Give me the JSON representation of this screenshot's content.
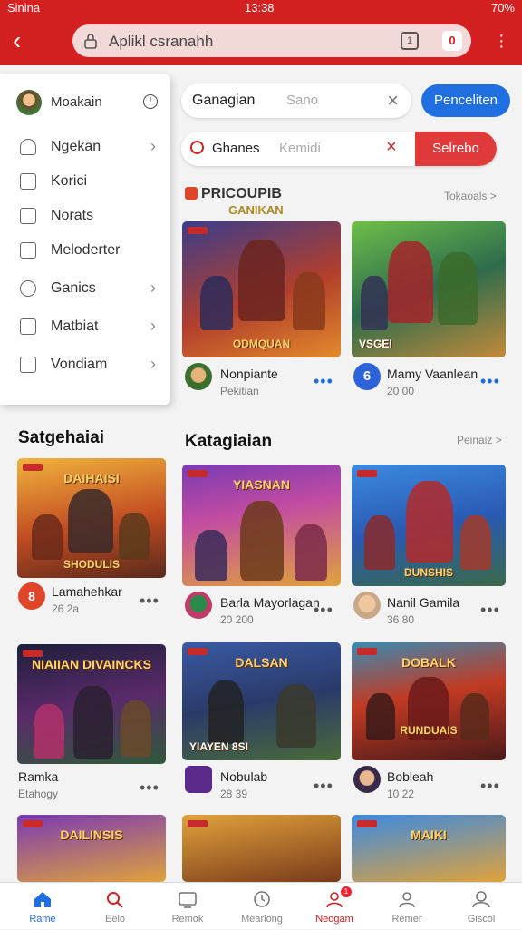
{
  "status": {
    "carrier": "Sinina",
    "time": "13:38",
    "battery": "70%"
  },
  "browser": {
    "url_text": "Aplikl csranahh",
    "tab_count": "1",
    "active_tab": "0"
  },
  "menu": {
    "header": "Moakain",
    "items": [
      {
        "label": "Ngekan",
        "icon": "person-icon",
        "chevron": true
      },
      {
        "label": "Korici",
        "icon": "bag-icon",
        "chevron": false
      },
      {
        "label": "Norats",
        "icon": "document-icon",
        "chevron": false
      },
      {
        "label": "Meloderter",
        "icon": "grid-icon",
        "chevron": false
      },
      {
        "label": "Ganics",
        "icon": "gamepad-icon",
        "chevron": true
      },
      {
        "label": "Matbiat",
        "icon": "bag-icon",
        "chevron": true
      },
      {
        "label": "Vondiam",
        "icon": "info-icon",
        "chevron": true
      }
    ]
  },
  "search1": {
    "label": "Ganagian",
    "placeholder": "Sano",
    "button": "Penceliten"
  },
  "search2": {
    "label": "Ghanes",
    "placeholder": "Kemidi",
    "button": "Selrebo"
  },
  "section_featured": {
    "title": "PRICOUPIB",
    "subtitle": "GANIKAN",
    "see_all": "Tokaoals >"
  },
  "featured": [
    {
      "banner": "ODMQUAN",
      "title": "Nonpiante",
      "sub": "Pekitian"
    },
    {
      "banner": "VSGEI",
      "title": "Mamy Vaanlean",
      "sub": "20 00"
    }
  ],
  "section_left": {
    "title": "Satgehaiai"
  },
  "section_right": {
    "title": "Katagiaian",
    "see_all": "Peinaiz >"
  },
  "left_cards": [
    {
      "banner_top": "DAIHAISI",
      "banner_bottom": "SHODULIS",
      "title": "Lamahehkar",
      "sub": "26 2a"
    },
    {
      "banner_top": "NIAIIAN DIVAINCKS",
      "banner_bottom": "",
      "title": "Ramka",
      "sub": "Etahogy"
    }
  ],
  "grid_cards": [
    {
      "banner_top": "YIASNAN",
      "banner_bottom": "",
      "title": "Barla Mayorlagan",
      "sub": "20 200"
    },
    {
      "banner_top": "",
      "banner_bottom": "DUNSHIS",
      "title": "Nanil Gamila",
      "sub": "36 80"
    },
    {
      "banner_top": "DALSAN",
      "banner_bottom": "YIAYEN 8SI",
      "title": "Nobulab",
      "sub": "28 39"
    },
    {
      "banner_top": "DOBALK",
      "banner_bottom": "RUNDUAIS",
      "title": "Bobleah",
      "sub": "10 22"
    }
  ],
  "bottom_row": [
    {
      "banner_top": "DAILINSIS"
    },
    {
      "banner_top": ""
    },
    {
      "banner_top": "MAIKI"
    }
  ],
  "nav": [
    {
      "label": "Rame",
      "icon": "home-icon"
    },
    {
      "label": "Eelo",
      "icon": "search-icon"
    },
    {
      "label": "Remok",
      "icon": "tv-icon"
    },
    {
      "label": "Mearlong",
      "icon": "clock-icon"
    },
    {
      "label": "Neogam",
      "icon": "users-icon",
      "badge": "1"
    },
    {
      "label": "Remer",
      "icon": "user-icon"
    },
    {
      "label": "Giscol",
      "icon": "profile-icon"
    }
  ]
}
